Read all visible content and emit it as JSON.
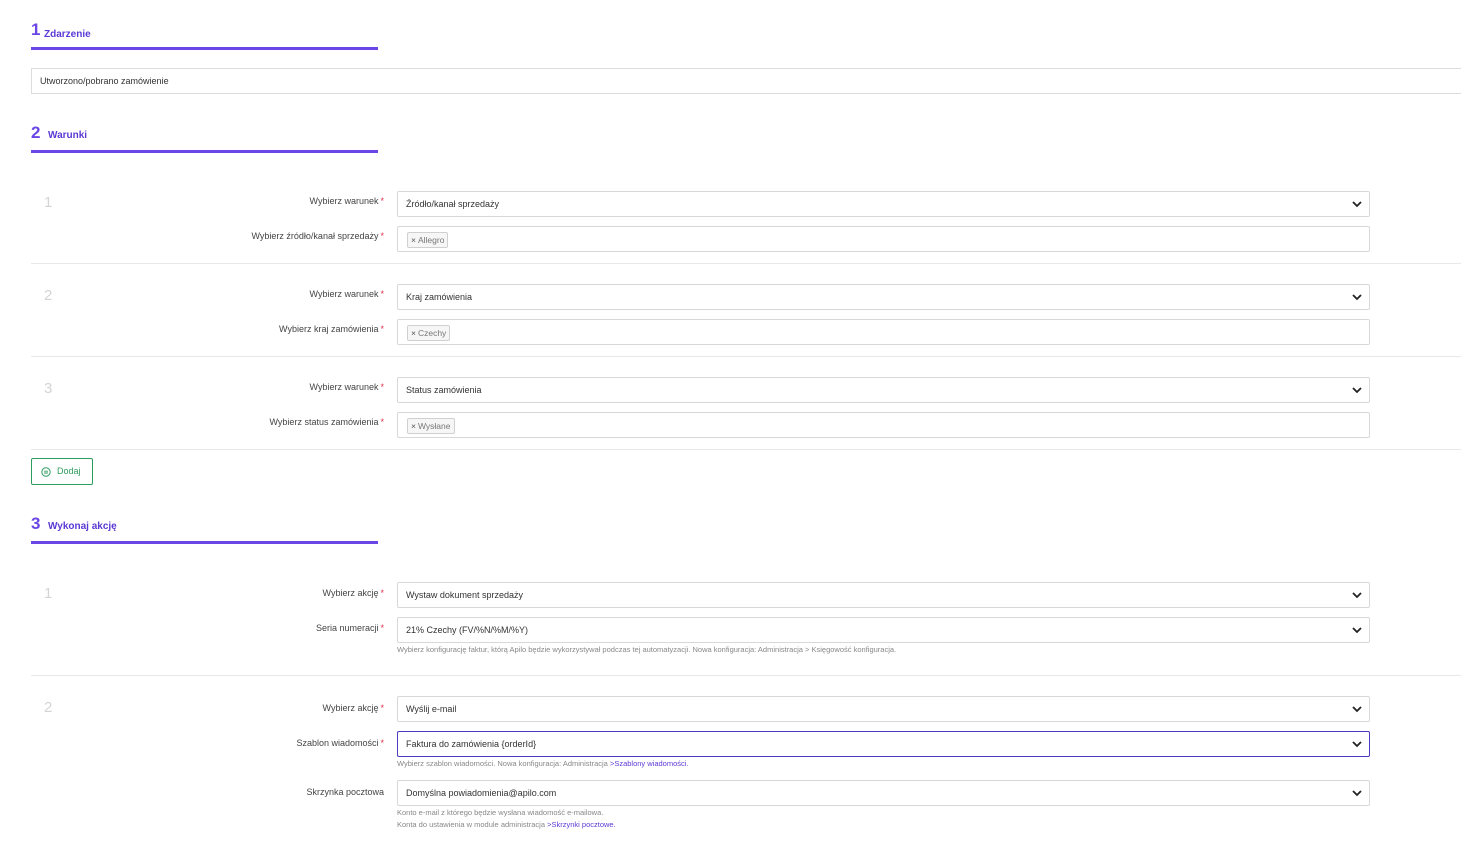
{
  "sections": [
    {
      "number": "1",
      "title": "Zdarzenie"
    },
    {
      "number": "2",
      "title": "Warunki"
    },
    {
      "number": "3",
      "title": "Wykonaj akcję"
    }
  ],
  "event": {
    "value": "Utworzono/pobrano zamówienie"
  },
  "conditions": [
    {
      "index": "1",
      "condition_label": "Wybierz warunek",
      "condition_value": "Źródło/kanał sprzedaży",
      "param_label": "Wybierz źródło/kanał sprzedaży",
      "tag": "Allegro"
    },
    {
      "index": "2",
      "condition_label": "Wybierz warunek",
      "condition_value": "Kraj zamówienia",
      "param_label": "Wybierz kraj zamówienia",
      "tag": "Czechy"
    },
    {
      "index": "3",
      "condition_label": "Wybierz warunek",
      "condition_value": "Status zamówienia",
      "param_label": "Wybierz status zamówienia",
      "tag": "Wysłane"
    }
  ],
  "add_button": {
    "label": "Dodaj"
  },
  "actions": [
    {
      "index": "1",
      "action_label": "Wybierz akcję",
      "action_value": "Wystaw dokument sprzedaży",
      "series_label": "Seria numeracji",
      "series_value": "21% Czechy (FV/%N/%M/%Y)",
      "series_help": "Wybierz konfigurację faktur, którą Apilo będzie wykorzystywał podczas tej automatyzacji. Nowa konfiguracja: Administracja > Księgowość konfiguracja."
    },
    {
      "index": "2",
      "action_label": "Wybierz akcję",
      "action_value": "Wyślij e-mail",
      "template_label": "Szablon wiadomości",
      "template_value": "Faktura do zamówienia {orderId}",
      "template_help_prefix": "Wybierz szablon wiadomości. Nowa konfiguracja: Administracja ",
      "template_help_link": ">Szablony wiadomości.",
      "mailbox_label": "Skrzynka pocztowa",
      "mailbox_value": "Domyślna powiadomienia@apilo.com",
      "mailbox_help_line1": "Konto e-mail z którego będzie wysłana wiadomość e-mailowa.",
      "mailbox_help_line2_prefix": "Konta do ustawienia w module administracja ",
      "mailbox_help_link": ">Skrzynki pocztowe."
    }
  ],
  "required_mark": "*",
  "tag_remove_glyph": "×",
  "icons": {
    "chevron": "chevron-down-icon",
    "add": "add-circle-icon"
  },
  "colors": {
    "accent": "#6a46e6",
    "required": "#e0304a",
    "add_button": "#2e9c5e"
  }
}
